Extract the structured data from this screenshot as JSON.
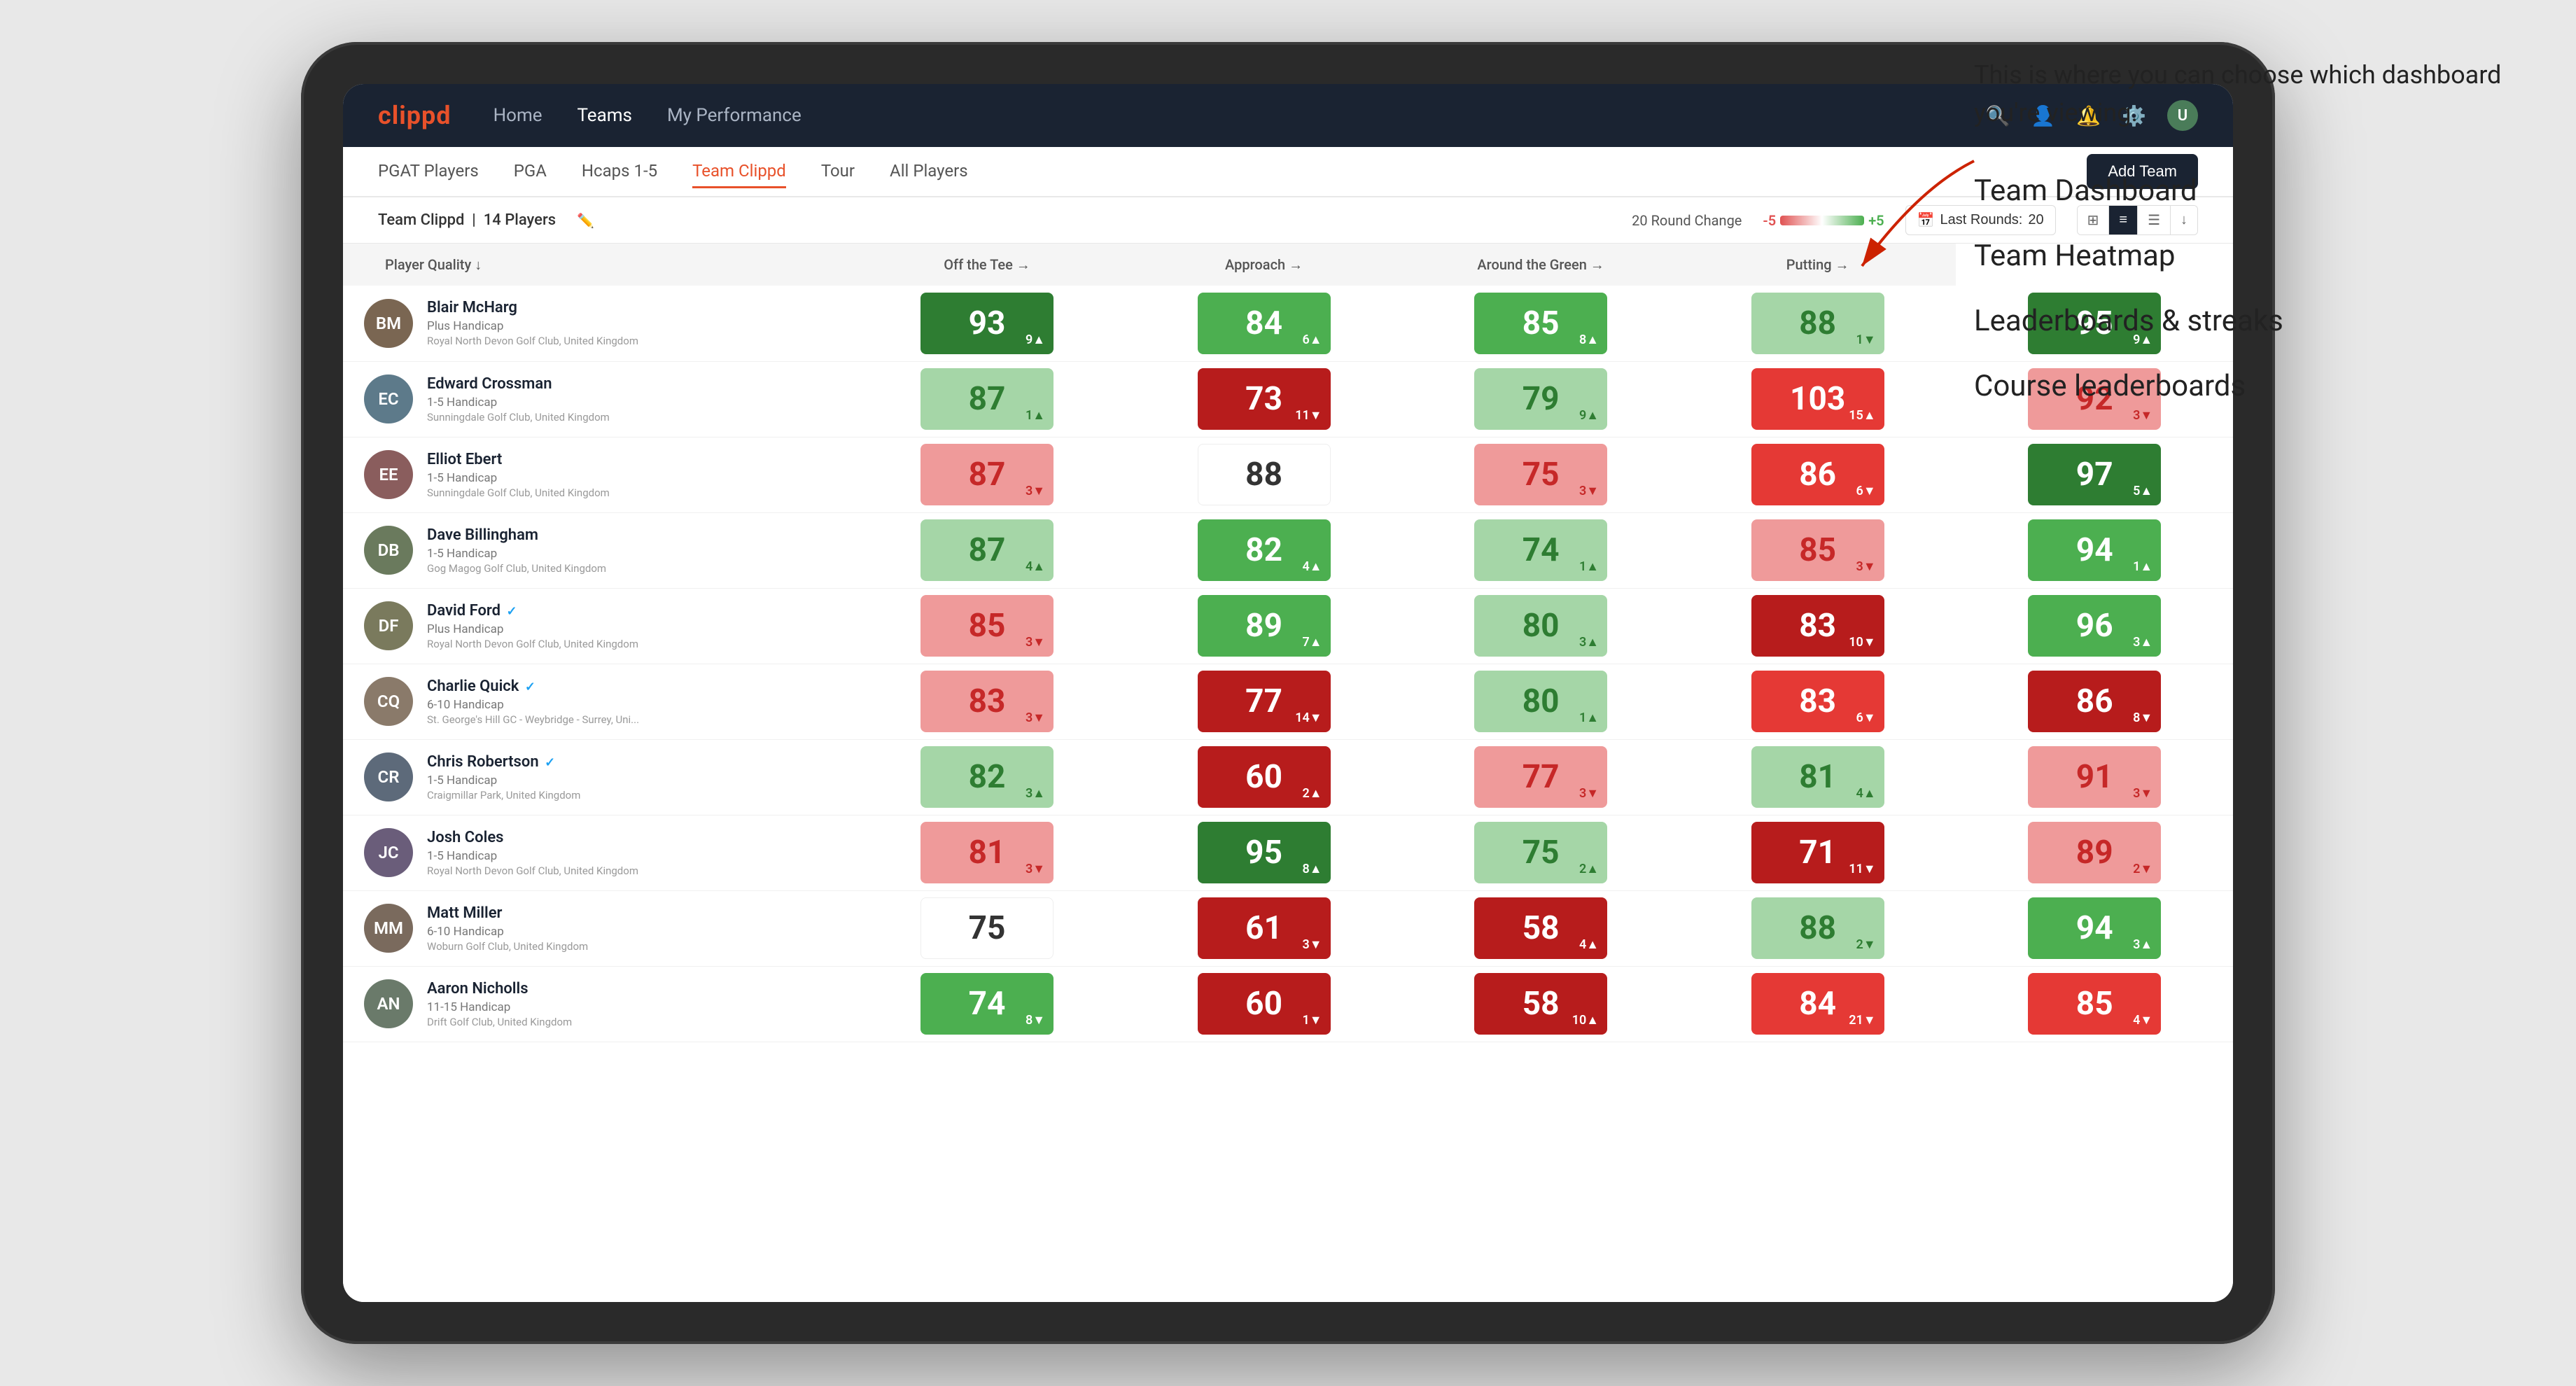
{
  "brand": "clippd",
  "navbar": {
    "links": [
      "Home",
      "Teams",
      "My Performance"
    ],
    "active": "Teams",
    "icons": [
      "🔍",
      "👤",
      "🔔",
      "⚙️"
    ]
  },
  "subnav": {
    "items": [
      "PGAT Players",
      "PGA",
      "Hcaps 1-5",
      "Team Clippd",
      "Tour",
      "All Players"
    ],
    "active": "Team Clippd",
    "add_btn": "Add Team"
  },
  "filterbar": {
    "team_label": "Team Clippd",
    "player_count": "14 Players",
    "round_change_label": "20 Round Change",
    "range_min": "-5",
    "range_max": "+5",
    "last_rounds_label": "Last Rounds:",
    "last_rounds_value": "20"
  },
  "table": {
    "headers": [
      "Player Quality ↓",
      "Off the Tee →",
      "Approach →",
      "Around the Green →",
      "Putting →"
    ],
    "rows": [
      {
        "name": "Blair McHarg",
        "handicap": "Plus Handicap",
        "club": "Royal North Devon Golf Club, United Kingdom",
        "initials": "BM",
        "avatar_color": "#7a6652",
        "scores": [
          {
            "value": 93,
            "change": "+9",
            "dir": "up",
            "color": "green-dark"
          },
          {
            "value": 84,
            "change": "+6",
            "dir": "up",
            "color": "green-mid"
          },
          {
            "value": 85,
            "change": "+8",
            "dir": "up",
            "color": "green-mid"
          },
          {
            "value": 88,
            "change": "-1",
            "dir": "down",
            "color": "green-light"
          },
          {
            "value": 95,
            "change": "+9",
            "dir": "up",
            "color": "green-dark"
          }
        ]
      },
      {
        "name": "Edward Crossman",
        "handicap": "1-5 Handicap",
        "club": "Sunningdale Golf Club, United Kingdom",
        "initials": "EC",
        "avatar_color": "#5d7a8a",
        "scores": [
          {
            "value": 87,
            "change": "+1",
            "dir": "up",
            "color": "green-light"
          },
          {
            "value": 73,
            "change": "-11",
            "dir": "down",
            "color": "red-dark"
          },
          {
            "value": 79,
            "change": "+9",
            "dir": "up",
            "color": "green-light"
          },
          {
            "value": 103,
            "change": "+15",
            "dir": "up",
            "color": "red-mid"
          },
          {
            "value": 92,
            "change": "-3",
            "dir": "down",
            "color": "red-light"
          }
        ]
      },
      {
        "name": "Elliot Ebert",
        "handicap": "1-5 Handicap",
        "club": "Sunningdale Golf Club, United Kingdom",
        "initials": "EE",
        "avatar_color": "#8a5d5d",
        "scores": [
          {
            "value": 87,
            "change": "-3",
            "dir": "down",
            "color": "red-light"
          },
          {
            "value": 88,
            "change": "",
            "dir": "",
            "color": "white-cell"
          },
          {
            "value": 75,
            "change": "-3",
            "dir": "down",
            "color": "red-light"
          },
          {
            "value": 86,
            "change": "-6",
            "dir": "down",
            "color": "red-mid"
          },
          {
            "value": 97,
            "change": "+5",
            "dir": "up",
            "color": "green-dark"
          }
        ]
      },
      {
        "name": "Dave Billingham",
        "handicap": "1-5 Handicap",
        "club": "Gog Magog Golf Club, United Kingdom",
        "initials": "DB",
        "avatar_color": "#6a7a5d",
        "scores": [
          {
            "value": 87,
            "change": "+4",
            "dir": "up",
            "color": "green-light"
          },
          {
            "value": 82,
            "change": "+4",
            "dir": "up",
            "color": "green-mid"
          },
          {
            "value": 74,
            "change": "+1",
            "dir": "up",
            "color": "green-light"
          },
          {
            "value": 85,
            "change": "-3",
            "dir": "down",
            "color": "red-light"
          },
          {
            "value": 94,
            "change": "+1",
            "dir": "up",
            "color": "green-mid"
          }
        ]
      },
      {
        "name": "David Ford",
        "handicap": "Plus Handicap",
        "club": "Royal North Devon Golf Club, United Kingdom",
        "initials": "DF",
        "avatar_color": "#7a7a5d",
        "verified": true,
        "scores": [
          {
            "value": 85,
            "change": "-3",
            "dir": "down",
            "color": "red-light"
          },
          {
            "value": 89,
            "change": "+7",
            "dir": "up",
            "color": "green-mid"
          },
          {
            "value": 80,
            "change": "+3",
            "dir": "up",
            "color": "green-light"
          },
          {
            "value": 83,
            "change": "-10",
            "dir": "down",
            "color": "red-dark"
          },
          {
            "value": 96,
            "change": "+3",
            "dir": "up",
            "color": "green-mid"
          }
        ]
      },
      {
        "name": "Charlie Quick",
        "handicap": "6-10 Handicap",
        "club": "St. George's Hill GC - Weybridge - Surrey, Uni...",
        "initials": "CQ",
        "avatar_color": "#8a7a6a",
        "verified": true,
        "scores": [
          {
            "value": 83,
            "change": "-3",
            "dir": "down",
            "color": "red-light"
          },
          {
            "value": 77,
            "change": "-14",
            "dir": "down",
            "color": "red-dark"
          },
          {
            "value": 80,
            "change": "+1",
            "dir": "up",
            "color": "green-light"
          },
          {
            "value": 83,
            "change": "-6",
            "dir": "down",
            "color": "red-mid"
          },
          {
            "value": 86,
            "change": "-8",
            "dir": "down",
            "color": "red-dark"
          }
        ]
      },
      {
        "name": "Chris Robertson",
        "handicap": "1-5 Handicap",
        "club": "Craigmillar Park, United Kingdom",
        "initials": "CR",
        "avatar_color": "#5d6a7a",
        "verified": true,
        "scores": [
          {
            "value": 82,
            "change": "+3",
            "dir": "up",
            "color": "green-light"
          },
          {
            "value": 60,
            "change": "+2",
            "dir": "up",
            "color": "red-dark"
          },
          {
            "value": 77,
            "change": "-3",
            "dir": "down",
            "color": "red-light"
          },
          {
            "value": 81,
            "change": "+4",
            "dir": "up",
            "color": "green-light"
          },
          {
            "value": 91,
            "change": "-3",
            "dir": "down",
            "color": "red-light"
          }
        ]
      },
      {
        "name": "Josh Coles",
        "handicap": "1-5 Handicap",
        "club": "Royal North Devon Golf Club, United Kingdom",
        "initials": "JC",
        "avatar_color": "#6a5d7a",
        "scores": [
          {
            "value": 81,
            "change": "-3",
            "dir": "down",
            "color": "red-light"
          },
          {
            "value": 95,
            "change": "+8",
            "dir": "up",
            "color": "green-dark"
          },
          {
            "value": 75,
            "change": "+2",
            "dir": "up",
            "color": "green-light"
          },
          {
            "value": 71,
            "change": "-11",
            "dir": "down",
            "color": "red-dark"
          },
          {
            "value": 89,
            "change": "-2",
            "dir": "down",
            "color": "red-light"
          }
        ]
      },
      {
        "name": "Matt Miller",
        "handicap": "6-10 Handicap",
        "club": "Woburn Golf Club, United Kingdom",
        "initials": "MM",
        "avatar_color": "#7a6a5d",
        "scores": [
          {
            "value": 75,
            "change": "",
            "dir": "",
            "color": "white-cell"
          },
          {
            "value": 61,
            "change": "-3",
            "dir": "down",
            "color": "red-dark"
          },
          {
            "value": 58,
            "change": "+4",
            "dir": "up",
            "color": "red-dark"
          },
          {
            "value": 88,
            "change": "-2",
            "dir": "down",
            "color": "green-light"
          },
          {
            "value": 94,
            "change": "+3",
            "dir": "up",
            "color": "green-mid"
          }
        ]
      },
      {
        "name": "Aaron Nicholls",
        "handicap": "11-15 Handicap",
        "club": "Drift Golf Club, United Kingdom",
        "initials": "AN",
        "avatar_color": "#6a7a6a",
        "scores": [
          {
            "value": 74,
            "change": "-8",
            "dir": "down",
            "color": "green-mid"
          },
          {
            "value": 60,
            "change": "-1",
            "dir": "down",
            "color": "red-dark"
          },
          {
            "value": 58,
            "change": "+10",
            "dir": "up",
            "color": "red-dark"
          },
          {
            "value": 84,
            "change": "-21",
            "dir": "down",
            "color": "red-mid"
          },
          {
            "value": 85,
            "change": "-4",
            "dir": "down",
            "color": "red-mid"
          }
        ]
      }
    ]
  },
  "annotation": {
    "intro": "This is where you can choose which dashboard you're viewing.",
    "items": [
      "Team Dashboard",
      "Team Heatmap",
      "Leaderboards & streaks",
      "Course leaderboards"
    ]
  }
}
